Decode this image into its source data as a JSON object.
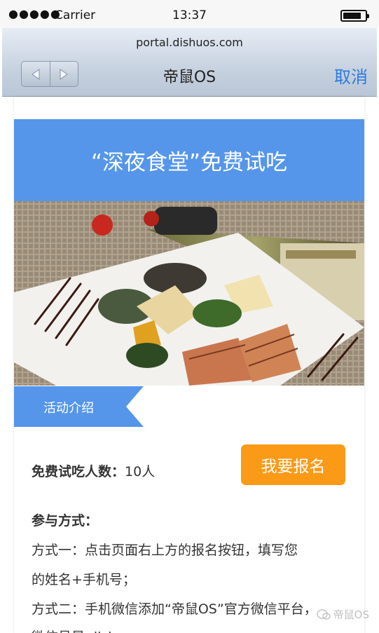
{
  "status_bar": {
    "signal": "●●●●●",
    "carrier": "Carrier",
    "time": "13:37"
  },
  "browser": {
    "url": "portal.dishuos.com",
    "title": "帝鼠OS",
    "cancel": "取消"
  },
  "hero": {
    "title": "“深夜食堂”免费试吃"
  },
  "section": {
    "label": "活动介绍"
  },
  "info": {
    "count_label": "免费试吃人数：",
    "count_value": "10人",
    "signup_button": "我要报名"
  },
  "content": {
    "heading": "参与方式：",
    "lines": [
      "方式一：点击页面右上方的报名按钮，填写您",
      "的姓名+手机号；",
      "方式二：手机微信添加“帝鼠OS”官方微信平台，",
      "微信号是 dishuos"
    ]
  },
  "watermark": {
    "text": "帝鼠OS"
  },
  "colors": {
    "accent_blue": "#5596ea",
    "signup_orange": "#fa9a16",
    "cancel_blue": "#2a7ae0"
  }
}
